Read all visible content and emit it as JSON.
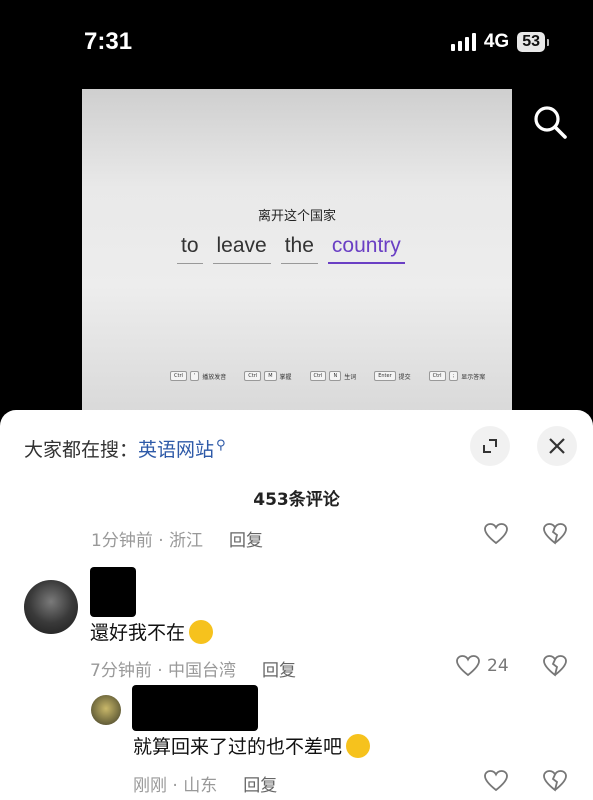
{
  "status_bar": {
    "time": "7:31",
    "network": "4G",
    "battery": "53"
  },
  "video": {
    "title_cn": "离开这个国家",
    "words": [
      "to",
      "leave",
      "the",
      "country"
    ],
    "hints": [
      {
        "key": "Ctrl",
        "key2": "'",
        "label": "播放发音"
      },
      {
        "key": "Ctrl",
        "key2": "M",
        "label": "掌握"
      },
      {
        "key": "Ctrl",
        "key2": "N",
        "label": "生词"
      },
      {
        "key": "Enter",
        "key2": "",
        "label": "提交"
      },
      {
        "key": "Ctrl",
        "key2": ";",
        "label": "显示答案"
      }
    ]
  },
  "sheet": {
    "search_prefix": "大家都在搜：",
    "search_term": "英语网站",
    "comment_count": "453条评论"
  },
  "comments": [
    {
      "meta": "1分钟前 · 浙江",
      "reply": "回复"
    },
    {
      "text": "還好我不在",
      "meta": "7分钟前 · 中国台湾",
      "reply": "回复",
      "likes": "24"
    },
    {
      "text": "就算回来了过的也不差吧",
      "meta": "刚刚 · 山东",
      "reply": "回复"
    }
  ],
  "icons": {
    "search": "search-icon",
    "expand": "expand-icon",
    "close": "close-icon",
    "like": "heart-icon",
    "dislike": "broken-heart-icon"
  },
  "colors": {
    "accent_purple": "#6a3fc4",
    "link_blue": "#2e5aa8"
  }
}
